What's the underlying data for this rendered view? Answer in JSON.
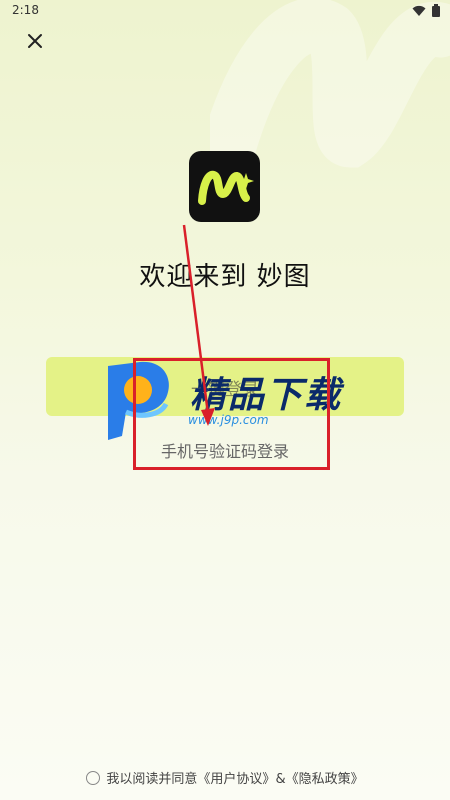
{
  "status_bar": {
    "time": "2:18"
  },
  "welcome_title": "欢迎来到 妙图",
  "primary_button_label": "一键登录",
  "sms_login_label": "手机号验证码登录",
  "watermark": {
    "text": "精品下载",
    "url": "www.j9p.com"
  },
  "footer": {
    "prefix": "我以阅读并同意",
    "user_agreement": "《用户协议》",
    "ampersand": "&",
    "privacy_policy": "《隐私政策》"
  },
  "colors": {
    "accent": "#e4f287",
    "logo_bg": "#111111",
    "logo_mark": "#d8f04a",
    "highlight": "#d9202a"
  }
}
